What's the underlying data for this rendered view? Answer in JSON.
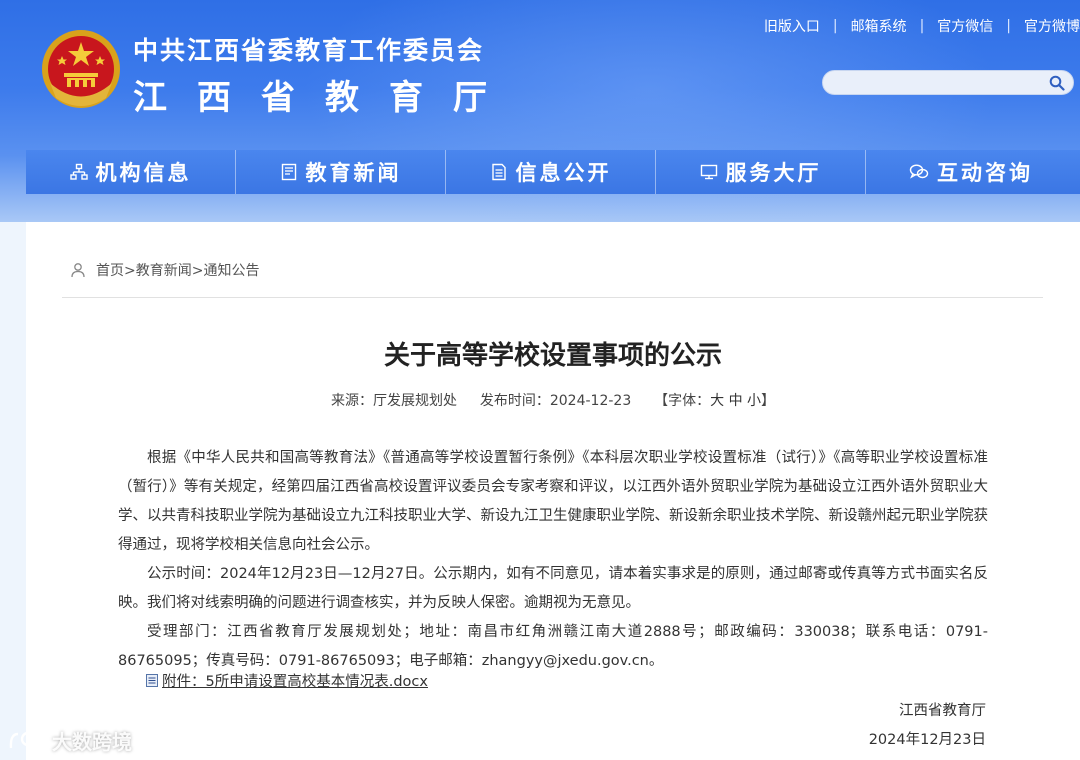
{
  "header": {
    "org_line1": "中共江西省委教育工作委员会",
    "org_line2": "江西省教育厅",
    "top_links": [
      "旧版入口",
      "邮箱系统",
      "官方微信",
      "官方微博"
    ],
    "search": {
      "value": "",
      "placeholder": ""
    },
    "icons": {
      "emblem": "national-emblem",
      "search": "search-icon"
    }
  },
  "nav": {
    "items": [
      {
        "label": "机构信息",
        "icon": "org-chart-icon"
      },
      {
        "label": "教育新闻",
        "icon": "news-icon"
      },
      {
        "label": "信息公开",
        "icon": "document-icon"
      },
      {
        "label": "服务大厅",
        "icon": "monitor-icon"
      },
      {
        "label": "互动咨询",
        "icon": "chat-bubbles-icon"
      }
    ]
  },
  "breadcrumb": {
    "icon": "user-location-icon",
    "items": [
      "首页>",
      "教育新闻>",
      "通知公告"
    ]
  },
  "article": {
    "title": "关于高等学校设置事项的公示",
    "source_label": "来源：",
    "source": "厅发展规划处",
    "date_label": "发布时间：",
    "date": "2024-12-23",
    "font_label": "【字体：",
    "font_large": "大",
    "font_medium": "中",
    "font_small": "小",
    "font_close": "】",
    "paragraphs": [
      "根据《中华人民共和国高等教育法》《普通高等学校设置暂行条例》《本科层次职业学校设置标准（试行）》《高等职业学校设置标准（暂行）》等有关规定，经第四届江西省高校设置评议委员会专家考察和评议，以江西外语外贸职业学院为基础设立江西外语外贸职业大学、以共青科技职业学院为基础设立九江科技职业大学、新设九江卫生健康职业学院、新设新余职业技术学院、新设赣州起元职业学院获得通过，现将学校相关信息向社会公示。",
      "公示时间：2024年12月23日—12月27日。公示期内，如有不同意见，请本着实事求是的原则，通过邮寄或传真等方式书面实名反映。我们将对线索明确的问题进行调查核实，并为反映人保密。逾期视为无意见。",
      "受理部门：江西省教育厅发展规划处；地址：南昌市红角洲赣江南大道2888号；邮政编码：330038；联系电话：0791-86765095；传真号码：0791-86765093；电子邮箱：zhangyy@jxedu.gov.cn。"
    ],
    "attachment": {
      "icon": "file-icon",
      "label": "附件：5所申请设置高校基本情况表.docx"
    },
    "signature": "江西省教育厅",
    "signature_date": "2024年12月23日"
  },
  "watermark": {
    "text": "大数跨境",
    "icon": "brand-logo-icon"
  }
}
